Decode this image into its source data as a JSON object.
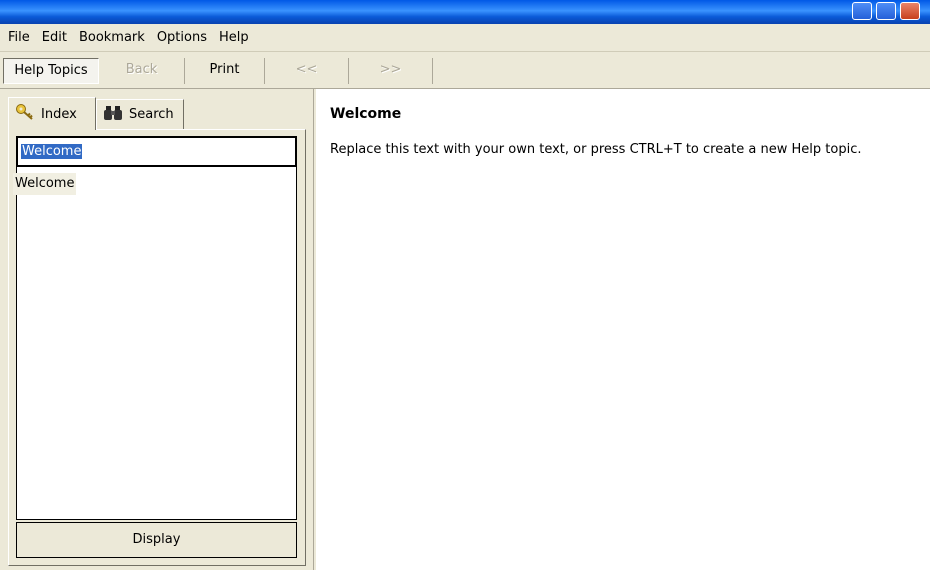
{
  "menubar": {
    "items": [
      {
        "label": "File"
      },
      {
        "label": "Edit"
      },
      {
        "label": "Bookmark"
      },
      {
        "label": "Options"
      },
      {
        "label": "Help"
      }
    ]
  },
  "toolbar": {
    "help_topics_label": "Help Topics",
    "back_label": "Back",
    "print_label": "Print",
    "prev_label": "<<",
    "next_label": ">>"
  },
  "tabs": {
    "index_label": "Index",
    "search_label": "Search"
  },
  "index": {
    "input_value": "Welcome",
    "items": [
      "Welcome"
    ],
    "display_label": "Display"
  },
  "topic": {
    "title": "Welcome",
    "body": "Replace this text with your own text, or press CTRL+T to create a new Help topic."
  },
  "icons": {
    "index_tab": "key-icon",
    "search_tab": "binoculars-icon"
  },
  "colors": {
    "selection": "#316ac5",
    "titlebar": "#0a5ad8",
    "chrome": "#ece9d8"
  }
}
